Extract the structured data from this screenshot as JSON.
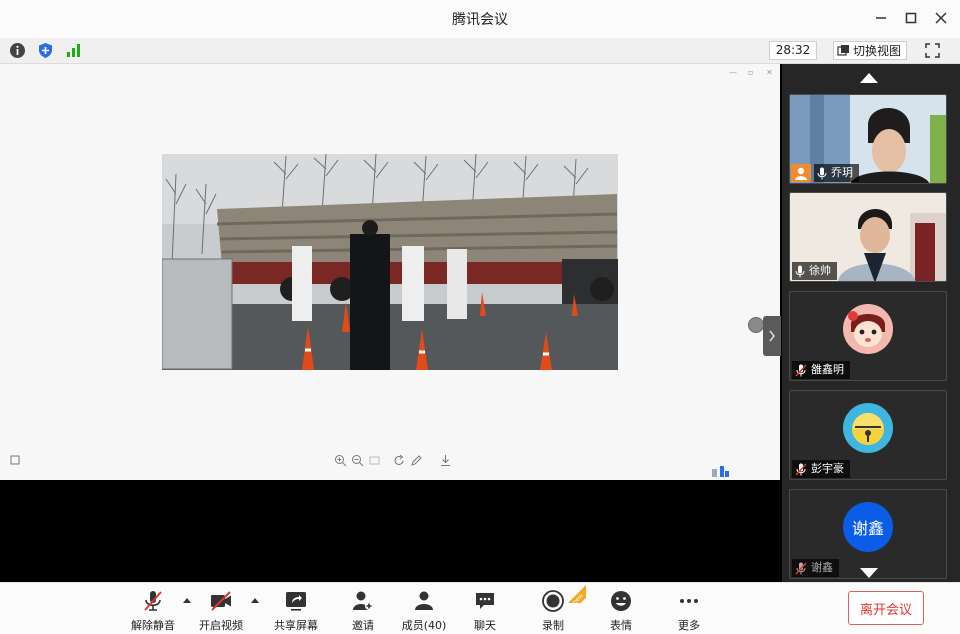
{
  "window": {
    "title": "腾讯会议"
  },
  "infobar": {
    "timer": "28:32",
    "switch_view_label": "切换视图"
  },
  "participants": [
    {
      "name": "乔玥",
      "kind": "video"
    },
    {
      "name": "徐帅",
      "kind": "video"
    },
    {
      "name": "雒鑫明",
      "kind": "avatar"
    },
    {
      "name": "彭宇豪",
      "kind": "avatar"
    },
    {
      "name": "谢鑫",
      "kind": "text-avatar",
      "avatar_text": "谢鑫"
    }
  ],
  "toolbar": {
    "unmute": "解除静音",
    "start_video": "开启视频",
    "share_screen": "共享屏幕",
    "invite": "邀请",
    "members": "成员(40)",
    "chat": "聊天",
    "record": "录制",
    "reactions": "表情",
    "more": "更多",
    "leave": "离开会议",
    "new_badge": "new"
  },
  "colors": {
    "accent": "#0b5ce6",
    "leave_red": "#e0362f",
    "signal_green": "#1aad19",
    "shield_blue": "#2b6de5"
  }
}
